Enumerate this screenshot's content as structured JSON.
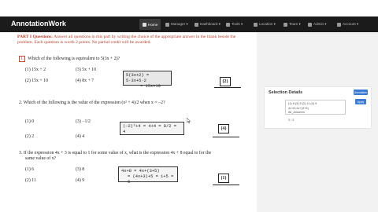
{
  "navbar": {
    "brand": "AnnotationWork",
    "items": [
      {
        "label": "Home",
        "icon": "home-icon",
        "active": true
      },
      {
        "label": "Manager ▾",
        "icon": "manager-icon",
        "active": false
      },
      {
        "label": "Dashboard ▾",
        "icon": "dashboard-icon",
        "active": false
      },
      {
        "label": "Tools ▾",
        "icon": "tools-icon",
        "active": false
      },
      {
        "label": "Location ▾",
        "icon": "location-icon",
        "active": false
      },
      {
        "label": "Team ▾",
        "icon": "team-icon",
        "active": false
      },
      {
        "label": "Admin ▾",
        "icon": "admin-icon",
        "active": false
      },
      {
        "label": "Account ▾",
        "icon": "account-icon",
        "active": false
      }
    ]
  },
  "document": {
    "instructions_prefix": "PART I Questions:",
    "instructions_body": " Answer all questions in this part by writing the choice of the appropriate answer in the blank beside the problem. Each question is worth 2 points. No partial credit will be awarded.",
    "questions": [
      {
        "num": "1.",
        "text": "Which of the following is equivalent to 5(3x + 2)?",
        "choices": [
          "(1) 15x + 2",
          "(3) 5x + 10",
          "(2) 15x + 10",
          "(4) 8x + 7"
        ],
        "work": [
          "5(3x+2) = 5·3x+5·2",
          "= 15x+10"
        ],
        "answer": "(2)"
      },
      {
        "num": "2.",
        "text": "Which of the following is the value of the expression (x² + 4)/2 when x = −2?",
        "choices": [
          "(1) 0",
          "(3) −1/2",
          "(2) 2",
          "(4) 4"
        ],
        "work": [
          "(−2)²+4 = 4+4 = 8/2 = 4"
        ],
        "answer": "(4)"
      },
      {
        "num": "3.",
        "text": "If the expression 4x + 3 is equal to 1 for some value of x, what is the expression 4x + 8 equal to for the",
        "text2": "same value of x?",
        "choices": [
          "(1) 6",
          "(3) 8",
          "(2) 11",
          "(4) 9"
        ],
        "work": [
          "4x+8 = 4x+(3+5)",
          "= (4x+3)+5 = 1+5 = 6"
        ],
        "answer": "(1)"
      }
    ]
  },
  "panel": {
    "title": "Selection Details",
    "header_button": "Annotation",
    "input_lines": [
      "(1) 6  (3) 8  (2) 11 (4) 9",
      "4x+8=4x+(3+5)",
      "All_Answers"
    ],
    "apply_button": "Apply",
    "count_text": "0 / 3"
  }
}
